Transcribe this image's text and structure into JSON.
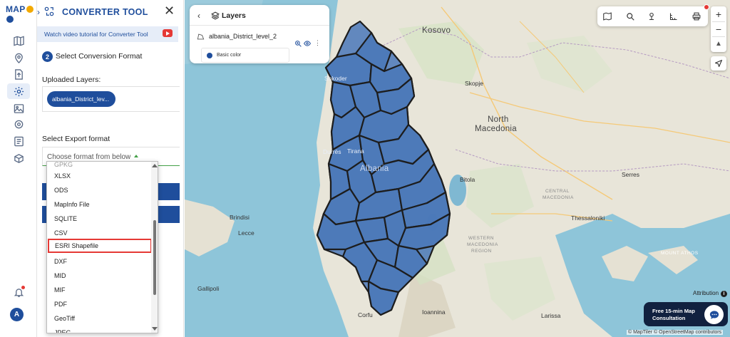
{
  "rail": {
    "logo_text": "MAP",
    "items": [
      "map-icon",
      "location-pin-icon",
      "upload-file-icon",
      "settings-gear-icon",
      "image-gallery-icon",
      "cog-icon",
      "checklist-icon",
      "package-icon"
    ],
    "bottom": [
      "bell-icon",
      "avatar"
    ],
    "avatar_initial": "A"
  },
  "panel": {
    "title": "CONVERTER TOOL",
    "tutorial": "Watch video tutorial for Converter Tool",
    "step_number": "2",
    "step_title": "Select Conversion Format",
    "uploaded_label": "Uploaded Layers:",
    "uploaded_chip": "albania_District_lev...",
    "export_label": "Select Export format",
    "format_placeholder": "Choose format from below"
  },
  "dropdown": {
    "items": [
      "XLSX",
      "ODS",
      "MapInfo File",
      "SQLITE",
      "CSV",
      "ESRI Shapefile",
      "DXF",
      "MID",
      "MIF",
      "PDF",
      "GeoTiff",
      "JPEG"
    ],
    "highlighted": "ESRI Shapefile"
  },
  "layers_panel": {
    "title": "Layers",
    "layer_name": "albania_District_level_2",
    "style_label": "Basic color",
    "fill_color": "#4a78b8"
  },
  "map": {
    "labels": {
      "kosovo": "Kosovo",
      "skopje": "Skopje",
      "north": "North",
      "macedonia": "Macedonia",
      "tirana": "Tirana",
      "albania": "Albania",
      "durres": "Durrës",
      "shkoder": "Shkoder",
      "bitola": "Bitola",
      "serres": "Serres",
      "brindisi": "Brindisi",
      "thessaloniki": "Thessaloniki",
      "western_macedonia_1": "WESTERN",
      "western_macedonia_2": "MACEDONIA",
      "western_macedonia_3": "REGION",
      "central_macedonia_1": "CENTRAL",
      "central_macedonia_2": "MACEDONIA",
      "mount_athos": "MOUNT ATHOS",
      "larissa": "Larissa",
      "ioannina": "Ioannina",
      "corfu": "Corfu",
      "gallipoli": "Gallipoli",
      "brindisi_area": "Lecce"
    },
    "attribution": "Attribution",
    "consult_text": "Free 15-min Map Consultation",
    "copyright": "© MapTiler © OpenStreetMap contributors"
  }
}
